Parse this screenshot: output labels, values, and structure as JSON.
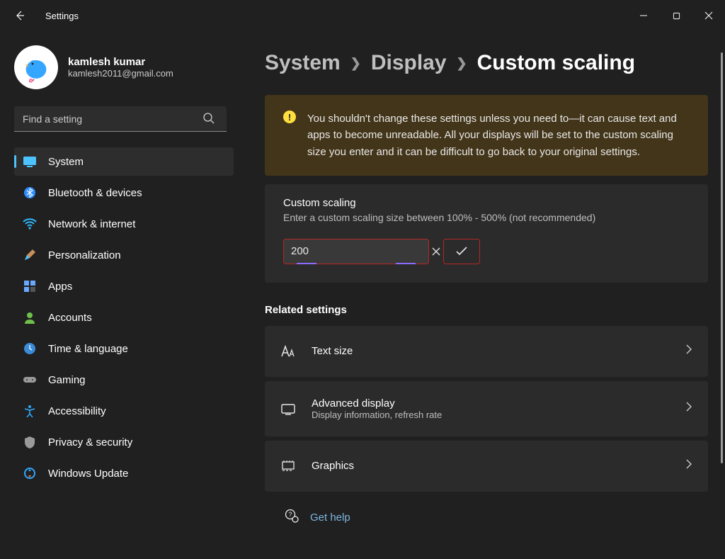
{
  "app": {
    "title": "Settings"
  },
  "user": {
    "name": "kamlesh kumar",
    "email": "kamlesh2011@gmail.com"
  },
  "search": {
    "placeholder": "Find a setting"
  },
  "nav": {
    "items": [
      {
        "label": "System"
      },
      {
        "label": "Bluetooth & devices"
      },
      {
        "label": "Network & internet"
      },
      {
        "label": "Personalization"
      },
      {
        "label": "Apps"
      },
      {
        "label": "Accounts"
      },
      {
        "label": "Time & language"
      },
      {
        "label": "Gaming"
      },
      {
        "label": "Accessibility"
      },
      {
        "label": "Privacy & security"
      },
      {
        "label": "Windows Update"
      }
    ]
  },
  "breadcrumb": {
    "a": "System",
    "b": "Display",
    "c": "Custom scaling"
  },
  "warning": {
    "badge": "!",
    "text": "You shouldn't change these settings unless you need to—it can cause text and apps to become unreadable. All your displays will be set to the custom scaling size you enter and it can be difficult to go back to your original settings."
  },
  "scaling": {
    "title": "Custom scaling",
    "subtitle": "Enter a custom scaling size between 100% - 500% (not recommended)",
    "value": "200"
  },
  "related": {
    "heading": "Related settings",
    "items": [
      {
        "title": "Text size",
        "subtitle": ""
      },
      {
        "title": "Advanced display",
        "subtitle": "Display information, refresh rate"
      },
      {
        "title": "Graphics",
        "subtitle": ""
      }
    ]
  },
  "help": {
    "label": "Get help"
  }
}
